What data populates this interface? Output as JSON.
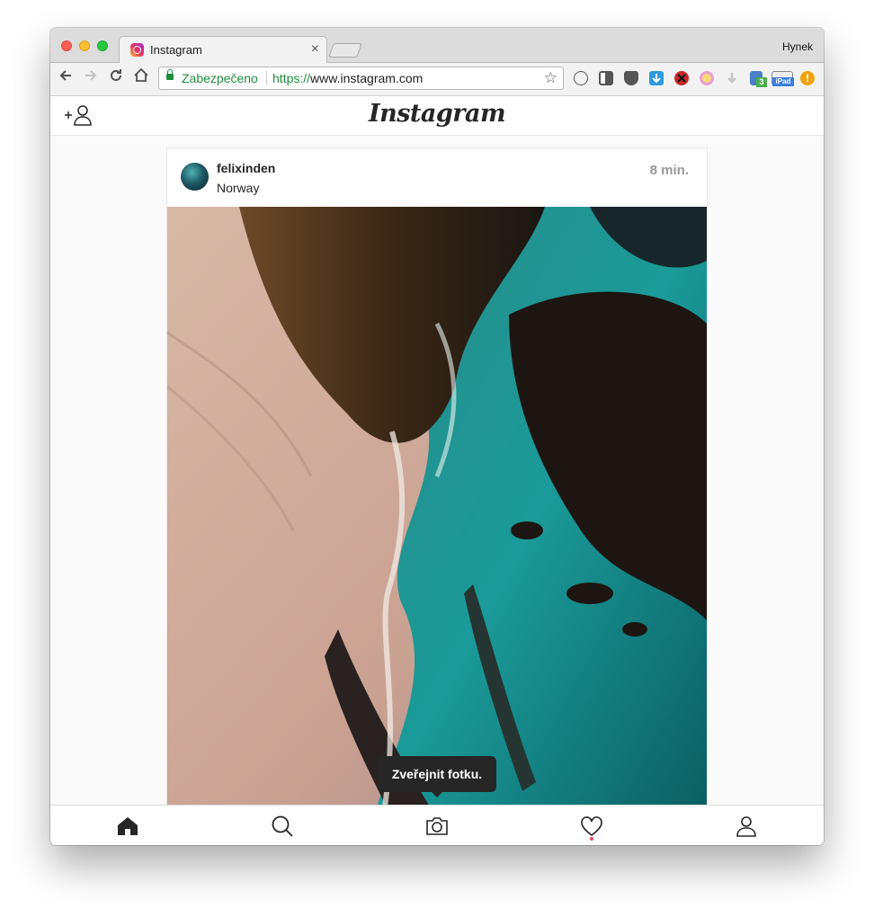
{
  "browser": {
    "tab_title": "Instagram",
    "tab_close": "×",
    "profile_name": "Hynek",
    "security_label": "Zabezpečeno",
    "url_scheme": "https://",
    "url_host": "www.instagram.com",
    "nav_icons": [
      "back-icon",
      "forward-icon",
      "reload-icon",
      "home-icon"
    ],
    "extensions": [
      "info-icon",
      "reader-icon",
      "pocket-icon",
      "download-icon",
      "block-icon",
      "lens-icon",
      "arrow-down-icon",
      "devtools-icon",
      "ipad-icon",
      "alert-icon"
    ],
    "ext_badges": {
      "devtools": "3",
      "ipad": "iPad",
      "alert": "!"
    }
  },
  "header": {
    "logo_text": "Instagram",
    "add_user_icon": "add-user-icon"
  },
  "post": {
    "username": "felixinden",
    "location": "Norway",
    "time": "8 min.",
    "photo": "aerial-coast-photo"
  },
  "tooltip": {
    "text": "Zveřejnit fotku."
  },
  "bottom_nav": [
    "home-icon",
    "search-icon",
    "camera-icon",
    "heart-icon",
    "profile-icon"
  ],
  "colors": {
    "secure_green": "#1e8e3e",
    "activity_dot": "#ed4956",
    "ig_text": "#262626"
  }
}
